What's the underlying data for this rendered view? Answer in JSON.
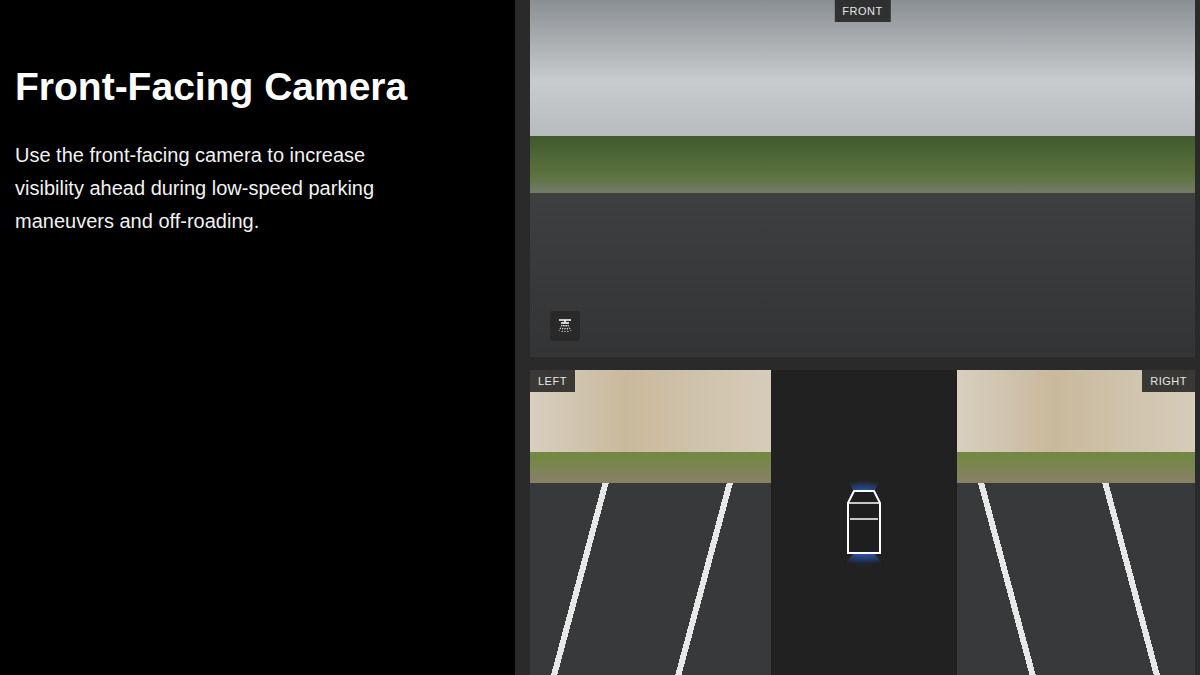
{
  "slide": {
    "title": "Front-Facing Camera",
    "description": "Use the front-facing camera to increase visibility ahead during low-speed parking maneuvers and off-roading."
  },
  "cameras": [
    {
      "label": "FRONT",
      "kind": "front"
    },
    {
      "label": "LEFT",
      "kind": "left"
    },
    {
      "label": "RIGHT",
      "kind": "right"
    }
  ]
}
